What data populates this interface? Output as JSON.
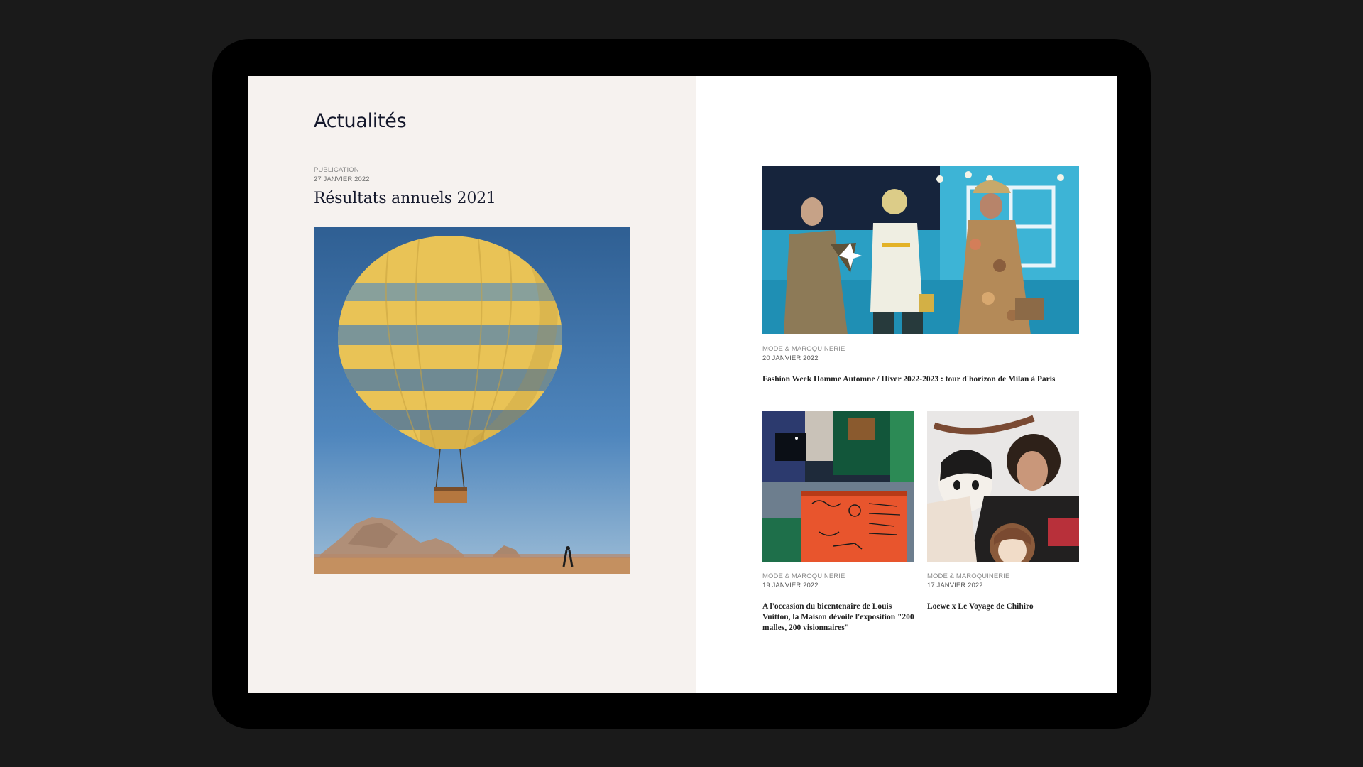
{
  "left_panel": {
    "title": "Actualités",
    "feature": {
      "category": "PUBLICATION",
      "date": "27 JANVIER 2022",
      "title": "Résultats annuels 2021",
      "image": "hot-air-balloon-desert"
    }
  },
  "articles": [
    {
      "category": "MODE & MAROQUINERIE",
      "date": "20 JANVIER 2022",
      "title": "Fashion Week Homme Automne / Hiver 2022-2023 : tour d'horizon de Milan à Paris",
      "image": "fashion-runway-models"
    },
    {
      "category": "MODE & MAROQUINERIE",
      "date": "19 JANVIER 2022",
      "title": "A l'occasion du bicentenaire de Louis Vuitton, la Maison dévoile l'exposition \"200 malles, 200 visionnaires\"",
      "image": "trunk-exhibition"
    },
    {
      "category": "MODE & MAROQUINERIE",
      "date": "17 JANVIER 2022",
      "title": "Loewe x Le Voyage de Chihiro",
      "image": "anime-print-model"
    }
  ],
  "colors": {
    "left_bg": "#f6f2ef",
    "right_bg": "#ffffff",
    "title": "#14182b",
    "device": "#000000",
    "backdrop": "#1a1a1a"
  }
}
